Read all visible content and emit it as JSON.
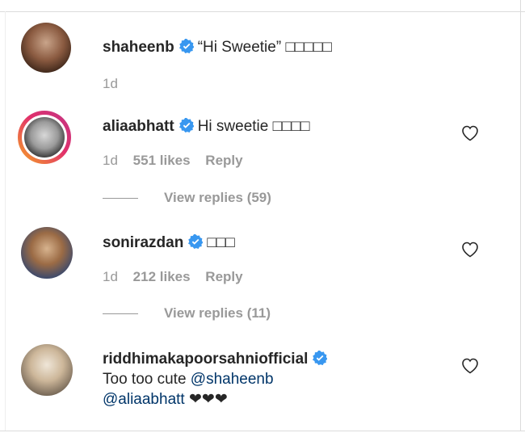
{
  "comments": [
    {
      "username": "shaheenb",
      "text": "“Hi Sweetie” □□□□□",
      "time": "1d",
      "avatar_icon": "profile-photo-icon"
    },
    {
      "username": "aliaabhatt",
      "text": "Hi sweetie □□□□",
      "time": "1d",
      "likes": "551 likes",
      "reply": "Reply",
      "view_replies": "View replies (59)",
      "avatar_icon": "profile-photo-icon"
    },
    {
      "username": "sonirazdan",
      "text": "□□□",
      "time": "1d",
      "likes": "212 likes",
      "reply": "Reply",
      "view_replies": "View replies (11)",
      "avatar_icon": "profile-photo-icon"
    },
    {
      "username": "riddhimakapoorsahniofficial",
      "text": "Too too cute ",
      "mention1": "@shaheenb",
      "mention2": "@aliaabhatt",
      "hearts": "❤❤❤",
      "avatar_icon": "profile-photo-icon"
    }
  ],
  "colors": {
    "verified": "#3897f0",
    "mention": "#003569",
    "muted": "#999999",
    "text": "#262626"
  }
}
